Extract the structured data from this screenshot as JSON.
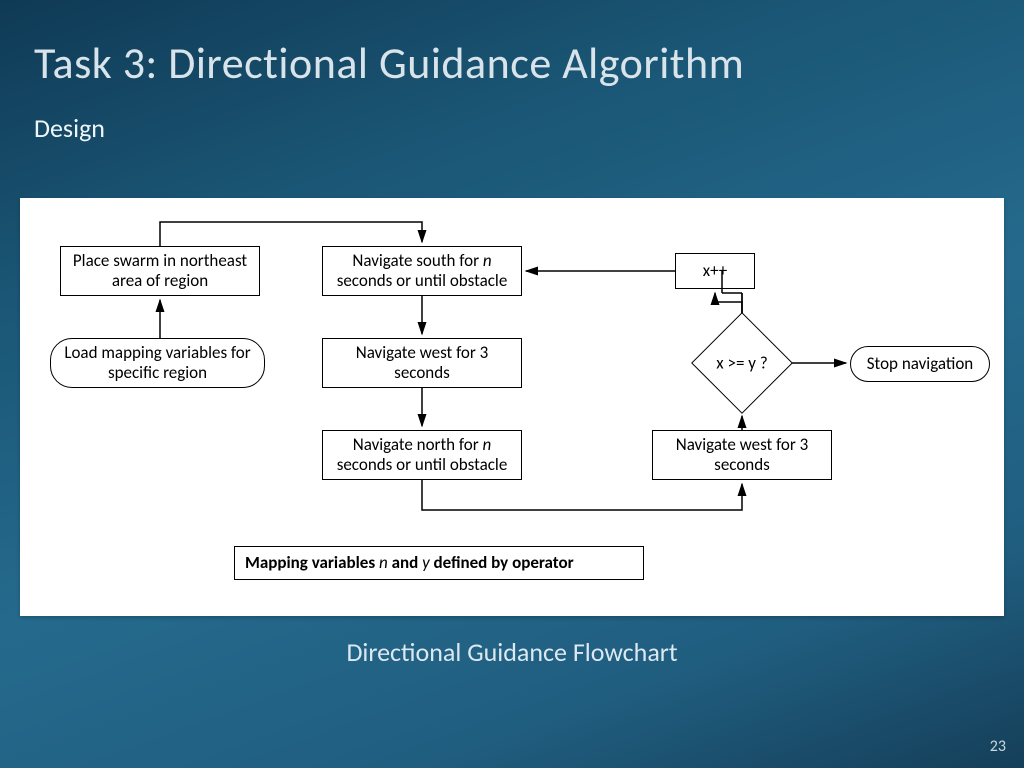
{
  "slide": {
    "title": "Task 3: Directional Guidance Algorithm",
    "subtitle": "Design",
    "caption": "Directional Guidance Flowchart",
    "page_number": "23"
  },
  "flowchart": {
    "load_vars": "Load mapping variables for specific region",
    "place_swarm": "Place swarm in northeast area of region",
    "nav_south_pre": "Navigate south for ",
    "nav_south_var": "n",
    "nav_south_post": " seconds or until obstacle",
    "nav_west1": "Navigate west for 3 seconds",
    "nav_north_pre": "Navigate north for ",
    "nav_north_var": "n",
    "nav_north_post": " seconds or until obstacle",
    "nav_west2": "Navigate west for 3 seconds",
    "decision": "x >= y ?",
    "increment": "x++",
    "stop": "Stop navigation",
    "footnote_pre": "Mapping variables ",
    "footnote_var1": "n",
    "footnote_mid": " and ",
    "footnote_var2": "y",
    "footnote_post": " defined by operator"
  }
}
